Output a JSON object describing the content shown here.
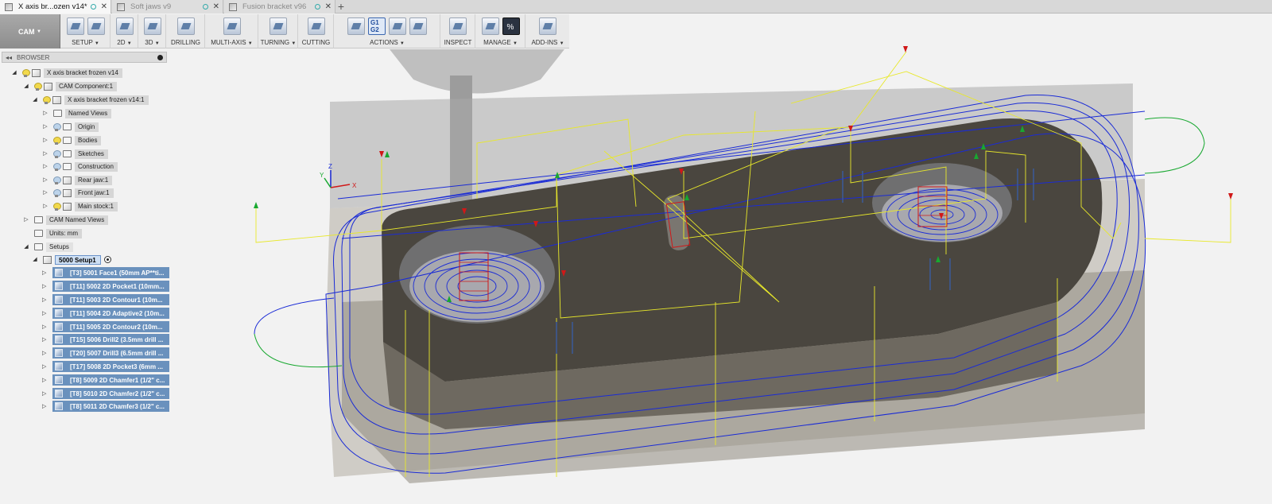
{
  "tabs": [
    {
      "label": "X axis br...ozen v14*",
      "active": true
    },
    {
      "label": "Soft jaws v9",
      "active": false
    },
    {
      "label": "Fusion bracket v96",
      "active": false
    }
  ],
  "toolbar": {
    "workspace": "CAM",
    "groups": [
      {
        "label": "SETUP",
        "dropdown": true
      },
      {
        "label": "2D",
        "dropdown": true
      },
      {
        "label": "3D",
        "dropdown": true
      },
      {
        "label": "DRILLING",
        "dropdown": false
      },
      {
        "label": "MULTI-AXIS",
        "dropdown": true
      },
      {
        "label": "TURNING",
        "dropdown": true
      },
      {
        "label": "CUTTING",
        "dropdown": false
      },
      {
        "label": "ACTIONS",
        "dropdown": true
      },
      {
        "label": "INSPECT",
        "dropdown": false
      },
      {
        "label": "MANAGE",
        "dropdown": true
      },
      {
        "label": "ADD-INS",
        "dropdown": true
      }
    ],
    "actions_g_text": "G1 G2",
    "manage_pct": "%"
  },
  "browser": {
    "title": "BROWSER",
    "tree": [
      {
        "label": "X axis bracket frozen v14"
      },
      {
        "label": "CAM Component:1"
      },
      {
        "label": "X axis bracket frozen v14:1"
      },
      {
        "label": "Named Views"
      },
      {
        "label": "Origin"
      },
      {
        "label": "Bodies"
      },
      {
        "label": "Sketches"
      },
      {
        "label": "Construction"
      },
      {
        "label": "Rear jaw:1"
      },
      {
        "label": "Front jaw:1"
      },
      {
        "label": "Main stock:1"
      },
      {
        "label": "CAM Named Views"
      },
      {
        "label": "Units: mm"
      },
      {
        "label": "Setups"
      },
      {
        "label": "5000 Setup1"
      }
    ],
    "operations": [
      "[T3] 5001 Face1 (50mm AP**ti...",
      "[T11] 5002 2D Pocket1 (10mm...",
      "[T11] 5003 2D Contour1 (10m...",
      "[T11] 5004 2D Adaptive2 (10m...",
      "[T11] 5005 2D Contour2 (10m...",
      "[T15] 5006 Drill2 (3.5mm drill ...",
      "[T20] 5007 Drill3 (6.5mm drill ...",
      "[T17] 5008 2D Pocket3 (6mm ...",
      "[T8] 5009 2D Chamfer1 (1/2\" c...",
      "[T8] 5010 2D Chamfer2 (1/2\" c...",
      "[T8] 5011 2D Chamfer3 (1/2\" c..."
    ]
  },
  "triad": {
    "x": "X",
    "y": "Y",
    "z": "Z"
  },
  "colors": {
    "toolpath_blue": "#1a2bd6",
    "rapid_yellow": "#e8e82a",
    "lead_green": "#18a830",
    "drill_red": "#d01818",
    "part_dark": "#4a463f",
    "stock_gray": "#8f8a80"
  }
}
